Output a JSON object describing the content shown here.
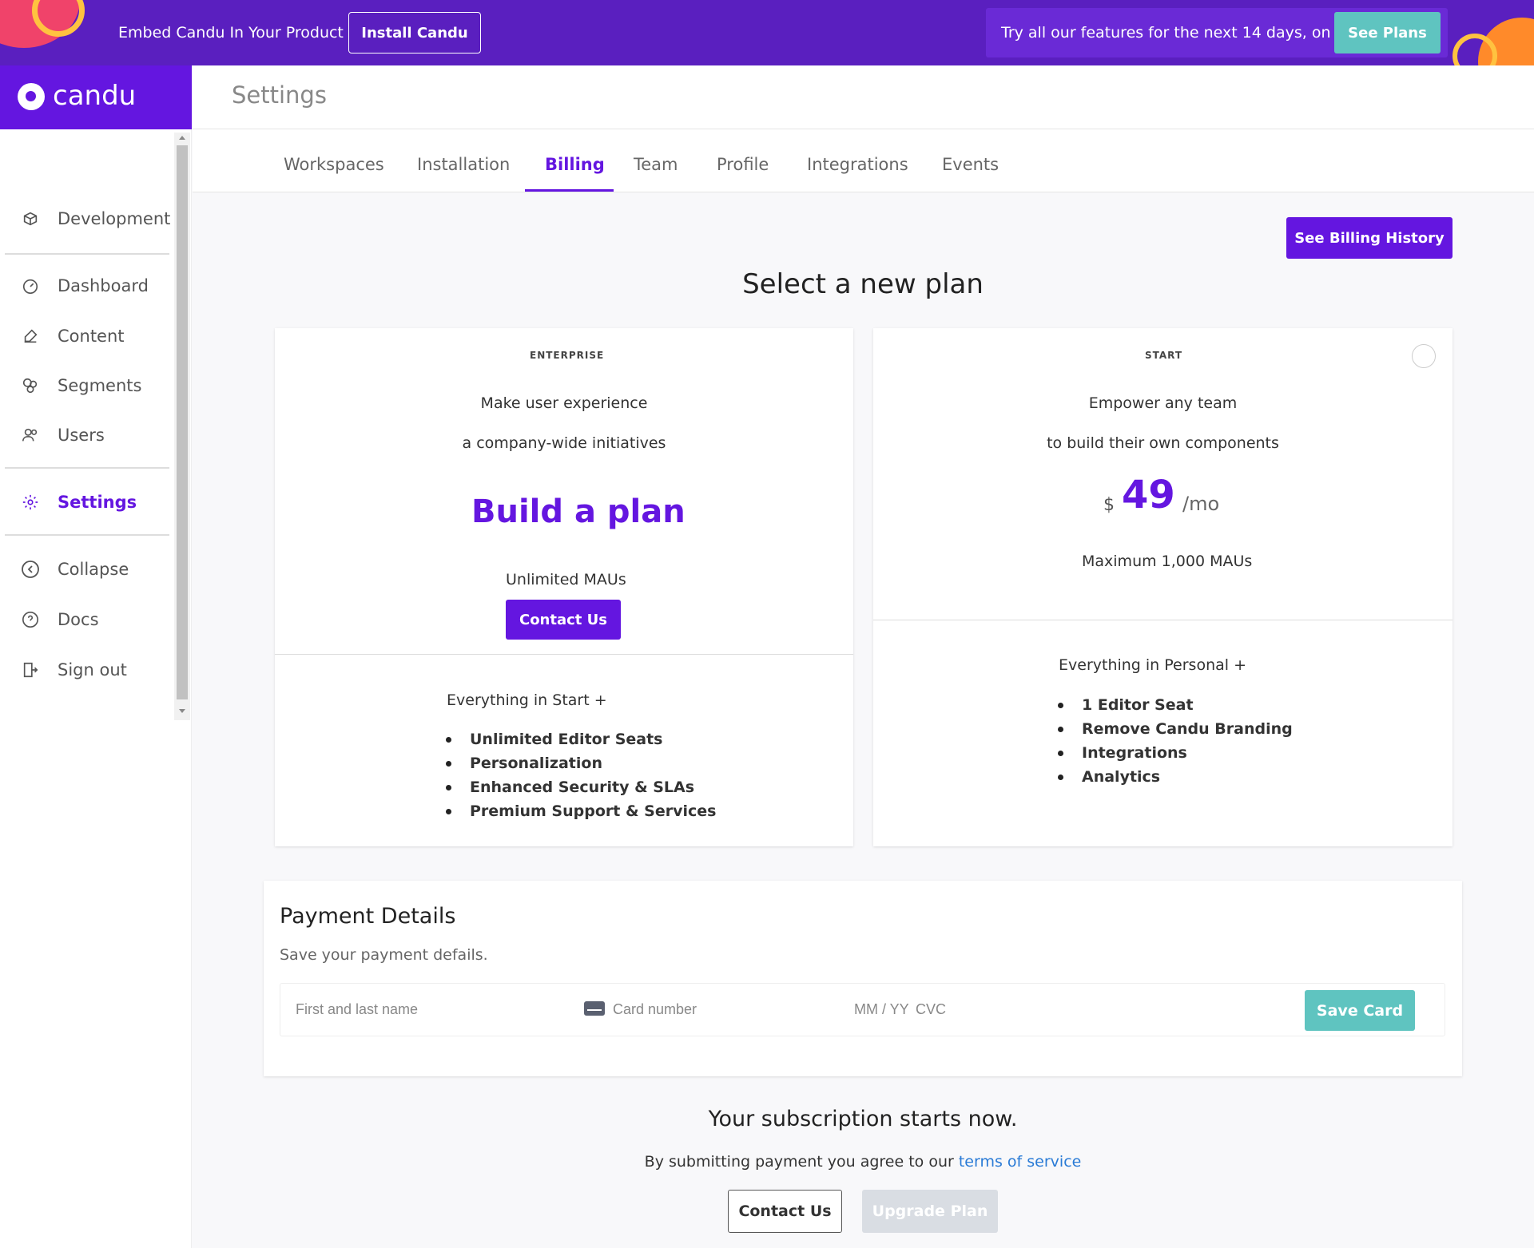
{
  "banner": {
    "embed_text": "Embed Candu In Your Product",
    "install_label": "Install Candu",
    "trial_text": "Try all our features for the next 14 days, on us.",
    "plans_label": "See Plans"
  },
  "brand": {
    "name": "candu"
  },
  "sidebar": {
    "items": [
      {
        "label": "Development",
        "icon": "cube-icon"
      },
      {
        "label": "Dashboard",
        "icon": "gauge-icon"
      },
      {
        "label": "Content",
        "icon": "edit-icon"
      },
      {
        "label": "Segments",
        "icon": "segments-icon"
      },
      {
        "label": "Users",
        "icon": "users-icon"
      },
      {
        "label": "Settings",
        "icon": "gear-icon",
        "active": true
      },
      {
        "label": "Collapse",
        "icon": "chevron-left-icon"
      },
      {
        "label": "Docs",
        "icon": "help-icon"
      },
      {
        "label": "Sign out",
        "icon": "sign-out-icon"
      }
    ]
  },
  "header": {
    "title": "Settings"
  },
  "tabs": [
    {
      "label": "Workspaces"
    },
    {
      "label": "Installation"
    },
    {
      "label": "Billing",
      "active": true
    },
    {
      "label": "Team"
    },
    {
      "label": "Profile"
    },
    {
      "label": "Integrations"
    },
    {
      "label": "Events"
    }
  ],
  "billing": {
    "history_label": "See Billing History",
    "select_title": "Select a new plan",
    "enterprise": {
      "label": "ENTERPRISE",
      "desc1": "Make user experience",
      "desc2": "a company-wide initiatives",
      "headline": "Build a plan",
      "mau": "Unlimited MAUs",
      "contact_label": "Contact Us",
      "everything": "Everything in Start +",
      "features": [
        "Unlimited Editor Seats",
        "Personalization",
        "Enhanced Security & SLAs",
        "Premium Support & Services"
      ]
    },
    "start": {
      "label": "START",
      "desc1": "Empower any team",
      "desc2": "to build their own components",
      "currency": "$",
      "price": "49",
      "period": "/mo",
      "mau": "Maximum 1,000 MAUs",
      "everything": "Everything in Personal +",
      "features": [
        "1 Editor Seat",
        "Remove Candu Branding",
        "Integrations",
        "Analytics"
      ]
    }
  },
  "payment": {
    "title": "Payment Details",
    "subtitle": "Save your payment defails.",
    "name_placeholder": "First and last name",
    "card_placeholder": "Card number",
    "expiry_placeholder": "MM / YY",
    "cvc_placeholder": "CVC",
    "save_label": "Save Card"
  },
  "footer": {
    "starts_now": "Your subscription starts now.",
    "agree_prefix": "By submitting payment you agree to our ",
    "terms_link": "terms of service",
    "contact_label": "Contact Us",
    "upgrade_label": "Upgrade Plan"
  },
  "colors": {
    "brand_purple": "#6416e0",
    "banner_purple": "#5a1fbf",
    "teal": "#5fc4c0",
    "link_blue": "#2a7bd6"
  }
}
